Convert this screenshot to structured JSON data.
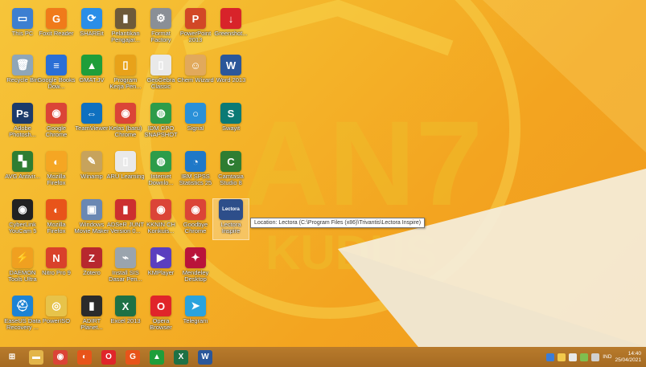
{
  "desktop": {
    "icons": [
      {
        "label": "This PC",
        "icon": "computer-icon",
        "color": "#3d7fd1",
        "glyph": "▭"
      },
      {
        "label": "Foxit Reader",
        "icon": "foxit-icon",
        "color": "#f07a1a",
        "glyph": "G"
      },
      {
        "label": "SHAREit",
        "icon": "shareit-icon",
        "color": "#2a8ee8",
        "glyph": "⟳"
      },
      {
        "label": "Pelantikan Pengajar...",
        "icon": "file-icon",
        "color": "#6d5a3a",
        "glyph": "▮"
      },
      {
        "label": "Format Factory",
        "icon": "formatfactory-icon",
        "color": "#8a8f96",
        "glyph": "⚙"
      },
      {
        "label": "PowerPoint 2013",
        "icon": "powerpoint-icon",
        "color": "#d24726",
        "glyph": "P"
      },
      {
        "label": "Greenshot...",
        "icon": "download-icon",
        "color": "#d8232a",
        "glyph": "↓"
      },
      {
        "label": "Recycle Bin",
        "icon": "recycle-bin-icon",
        "color": "#8fa6b8",
        "glyph": "🗑"
      },
      {
        "label": "Google Books Dow...",
        "icon": "books-icon",
        "color": "#2a6fd6",
        "glyph": "≡"
      },
      {
        "label": "GMAT.JV",
        "icon": "triangle-icon",
        "color": "#1f9e3a",
        "glyph": "▲"
      },
      {
        "label": "Program Kerja Pen...",
        "icon": "folder-icon",
        "color": "#e8a21a",
        "glyph": "▯"
      },
      {
        "label": "GeoGebra Classic",
        "icon": "file-icon",
        "color": "#e9e9e9",
        "glyph": "▯"
      },
      {
        "label": "Chem Wizard",
        "icon": "character-icon",
        "color": "#e1a95c",
        "glyph": "☺"
      },
      {
        "label": "Word 2013",
        "icon": "word-icon",
        "color": "#2b579a",
        "glyph": "W"
      },
      {
        "label": "Adobe Photosh...",
        "icon": "photoshop-icon",
        "color": "#1c3b6b",
        "glyph": "Ps"
      },
      {
        "label": "Google Chrome",
        "icon": "chrome-icon",
        "color": "#db4437",
        "glyph": "◉"
      },
      {
        "label": "TeamViewer",
        "icon": "teamviewer-icon",
        "color": "#0e70c0",
        "glyph": "⇔"
      },
      {
        "label": "Kelas (baru) Chrome",
        "icon": "chrome-icon",
        "color": "#db4437",
        "glyph": "◉"
      },
      {
        "label": "IDM GPO SNAPSHOT",
        "icon": "globe-icon",
        "color": "#2d9c4a",
        "glyph": "◍"
      },
      {
        "label": "Signal",
        "icon": "signal-icon",
        "color": "#2a90d8",
        "glyph": "○"
      },
      {
        "label": "Swayit",
        "icon": "sway-icon",
        "color": "#0b7a75",
        "glyph": "S"
      },
      {
        "label": "AVG Antivir...",
        "icon": "avg-icon",
        "color": "#2e7d32",
        "glyph": "▚"
      },
      {
        "label": "Mozilla Firefox",
        "icon": "firefox-icon",
        "color": "#f5a623",
        "glyph": "◐"
      },
      {
        "label": "Winamp",
        "icon": "winamp-icon",
        "color": "#c7a35c",
        "glyph": "✎"
      },
      {
        "label": "ARU Learning",
        "icon": "file-icon",
        "color": "#e9e9e9",
        "glyph": "▯"
      },
      {
        "label": "Internet Downlo...",
        "icon": "globe-icon",
        "color": "#2d9c4a",
        "glyph": "◍"
      },
      {
        "label": "IBM SPSS Statistics 25",
        "icon": "spss-icon",
        "color": "#1f78c8",
        "glyph": "◔"
      },
      {
        "label": "Camtasia Studio 8",
        "icon": "camtasia-icon",
        "color": "#2e7d32",
        "glyph": "C"
      },
      {
        "label": "CyberLink YouCam 5",
        "icon": "webcam-icon",
        "color": "#222222",
        "glyph": "◉"
      },
      {
        "label": "Mozilla Firefox",
        "icon": "firefox-icon",
        "color": "#e8541a",
        "glyph": "◐"
      },
      {
        "label": "Windows Movie Maker",
        "icon": "moviemaker-icon",
        "color": "#6a88b3",
        "glyph": "▣"
      },
      {
        "label": "ADSeR JUNT Version 0...",
        "icon": "app-icon",
        "color": "#cc2f2f",
        "glyph": "▮"
      },
      {
        "label": "KKNIN CH Konkuis...",
        "icon": "chrome-icon",
        "color": "#db4437",
        "glyph": "◉"
      },
      {
        "label": "Goodbye Chrome",
        "icon": "chrome-icon",
        "color": "#db4437",
        "glyph": "◉"
      },
      {
        "label": "Lectora Inspire",
        "icon": "lectora-icon",
        "color": "#2d4e8a",
        "glyph": "Lectora"
      },
      {
        "label": "DAEMON Tools Ultra",
        "icon": "daemon-icon",
        "color": "#f0a020",
        "glyph": "⚡"
      },
      {
        "label": "Nitro Pro 9",
        "icon": "nitro-icon",
        "color": "#d9412b",
        "glyph": "N"
      },
      {
        "label": "Zotero",
        "icon": "zotero-icon",
        "color": "#b7282e",
        "glyph": "Z"
      },
      {
        "label": "Install SIS Dasar Pen...",
        "icon": "usb-icon",
        "color": "#9aa4ad",
        "glyph": "⌁"
      },
      {
        "label": "KMPlayer",
        "icon": "kmplayer-icon",
        "color": "#5a3fbf",
        "glyph": "▶"
      },
      {
        "label": "Mendeley Desktop",
        "icon": "mendeley-icon",
        "color": "#b9133a",
        "glyph": "✦"
      },
      {
        "label": "EaseUS Data Recovery ...",
        "icon": "recovery-icon",
        "color": "#1d83d4",
        "glyph": "⛑"
      },
      {
        "label": "PowerISO",
        "icon": "disc-icon",
        "color": "#e7c34a",
        "glyph": "◎"
      },
      {
        "label": "ADIRT Planet...",
        "icon": "file-icon",
        "color": "#2b2b2b",
        "glyph": "▮"
      },
      {
        "label": "Excel 2013",
        "icon": "excel-icon",
        "color": "#1e7145",
        "glyph": "X"
      },
      {
        "label": "Opera Browser",
        "icon": "opera-icon",
        "color": "#e0252a",
        "glyph": "O"
      },
      {
        "label": "Telegram",
        "icon": "telegram-icon",
        "color": "#2aa3dd",
        "glyph": "➤"
      }
    ],
    "tooltip": "Location: Lectora (C:\\Program Files (x86)\\Trivantis\\Lectora Inspire)"
  },
  "taskbar": {
    "items": [
      {
        "icon": "windows-start-icon",
        "color": "#ffffff",
        "glyph": "⊞"
      },
      {
        "icon": "file-explorer-icon",
        "color": "#e3b54a",
        "glyph": "▬"
      },
      {
        "icon": "chrome-icon",
        "color": "#db4437",
        "glyph": "◉"
      },
      {
        "icon": "firefox-icon",
        "color": "#e8541a",
        "glyph": "◐"
      },
      {
        "icon": "opera-icon",
        "color": "#e0252a",
        "glyph": "O"
      },
      {
        "icon": "foxit-icon",
        "color": "#e8541a",
        "glyph": "G"
      },
      {
        "icon": "triangle-icon",
        "color": "#1f9e3a",
        "glyph": "▲"
      },
      {
        "icon": "excel-icon",
        "color": "#1e7145",
        "glyph": "X"
      },
      {
        "icon": "word-icon",
        "color": "#2b579a",
        "glyph": "W"
      }
    ],
    "tray": {
      "lang": "IND",
      "time": "14:40",
      "date": "25/04/2021"
    }
  }
}
